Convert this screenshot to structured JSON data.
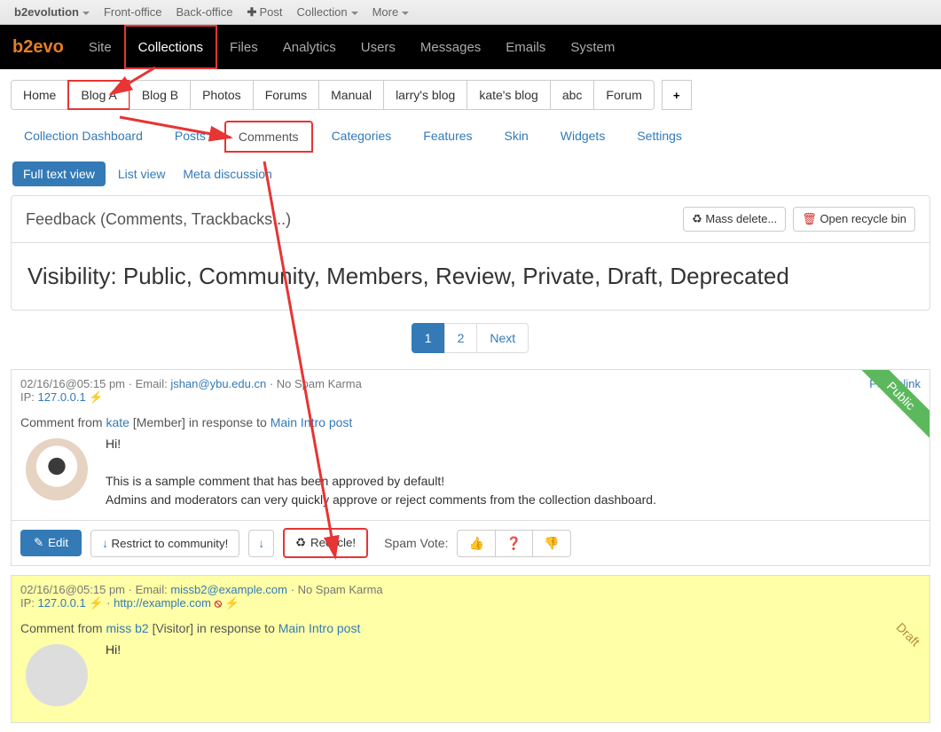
{
  "topbar": {
    "brand": "b2evolution",
    "items": [
      "Front-office",
      "Back-office"
    ],
    "post": "Post",
    "collection": "Collection",
    "more": "More"
  },
  "navbar": {
    "brand": "b2evo",
    "items": [
      "Site",
      "Collections",
      "Files",
      "Analytics",
      "Users",
      "Messages",
      "Emails",
      "System"
    ],
    "activeIndex": 1
  },
  "collections_row": {
    "items": [
      "Home",
      "Blog A",
      "Blog B",
      "Photos",
      "Forums",
      "Manual",
      "larry's blog",
      "kate's blog",
      "abc",
      "Forum"
    ],
    "highlightIndex": 1,
    "add": "+"
  },
  "tabs": {
    "items": [
      "Collection Dashboard",
      "Posts",
      "Comments",
      "Categories",
      "Features",
      "Skin",
      "Widgets",
      "Settings"
    ],
    "highlightIndex": 2
  },
  "views": {
    "full": "Full text view",
    "list": "List view",
    "meta": "Meta discussion"
  },
  "panel": {
    "title": "Feedback (Comments, Trackbacks...)",
    "massdelete": "Mass delete...",
    "recyclebin": "Open recycle bin",
    "visibility": "Visibility: Public, Community, Members, Review, Private, Draft, Deprecated"
  },
  "pagination": {
    "pages": [
      "1",
      "2",
      "Next"
    ],
    "active": 0
  },
  "comment1": {
    "date": "02/16/16@05:15 pm",
    "email_lbl": "Email: ",
    "email": "jshan@ybu.edu.cn",
    "spam": "No Spam Karma",
    "ip_lbl": "IP: ",
    "ip": "127.0.0.1",
    "permalink": "Permalink",
    "from_pre": "Comment from ",
    "author": "kate",
    "member": " [Member] in response to ",
    "post": "Main Intro post",
    "line1": "Hi!",
    "line2": "This is a sample comment that has been approved by default!",
    "line3": "Admins and moderators can very quickly approve or reject comments from the collection dashboard.",
    "ribbon": "Public",
    "toolbar": {
      "edit": "Edit",
      "restrict": "Restrict to community!",
      "recycle": "Recycle!",
      "spamvote": "Spam Vote:"
    }
  },
  "comment2": {
    "date": "02/16/16@05:15 pm",
    "email_lbl": "Email: ",
    "email": "missb2@example.com",
    "spam": "No Spam Karma",
    "ip_lbl": "IP: ",
    "ip": "127.0.0.1",
    "url": "http://example.com",
    "from_pre": "Comment from ",
    "author": "miss b2",
    "member": " [Visitor] in response to ",
    "post": "Main Intro post",
    "line1": "Hi!",
    "ribbon": "Draft"
  }
}
